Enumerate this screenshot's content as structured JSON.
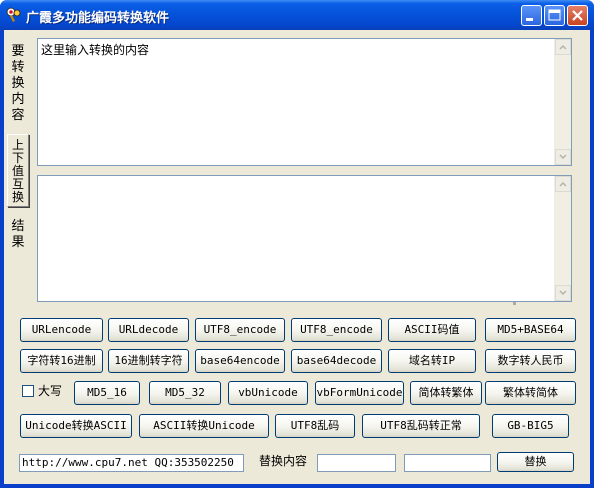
{
  "window": {
    "title": "广霞多功能编码转换软件"
  },
  "labels": {
    "input_vertical": "要转换内容",
    "result_vertical": "结果",
    "uppercase": "大写",
    "replace_content": "替换内容"
  },
  "input_area": {
    "value": "这里输入转换的内容"
  },
  "result_area": {
    "value": ""
  },
  "swap_button": {
    "label": "上下值互换"
  },
  "buttons": {
    "urlencode": "URLencode",
    "urldecode": "URLdecode",
    "utf8_encode_1": "UTF8_encode",
    "utf8_encode_2": "UTF8_encode",
    "ascii_code": "ASCII码值",
    "md5_base64": "MD5+BASE64",
    "char_to_hex": "字符转16进制",
    "hex_to_char": "16进制转字符",
    "base64encode": "base64encode",
    "base64decode": "base64decode",
    "domain_to_ip": "域名转IP",
    "num_to_rmb": "数字转人民币",
    "md5_16": "MD5_16",
    "md5_32": "MD5_32",
    "vbunicode": "vbUnicode",
    "vbformunicode": "vbFormUnicode",
    "simp_to_trad": "简体转繁体",
    "trad_to_simp": "繁体转简体",
    "unicode_to_ascii": "Unicode转换ASCII",
    "ascii_to_unicode": "ASCII转换Unicode",
    "utf8_garble": "UTF8乱码",
    "utf8_fix": "UTF8乱码转正常",
    "gb_big5": "GB-BIG5",
    "replace": "替换"
  },
  "footer": {
    "info": "http://www.cpu7.net QQ:353502250",
    "find_value": "",
    "replace_value": ""
  },
  "colors": {
    "titlebar": "#0552d9",
    "client": "#ece9d8",
    "button_border": "#003c74",
    "field_border": "#7f9db9"
  }
}
